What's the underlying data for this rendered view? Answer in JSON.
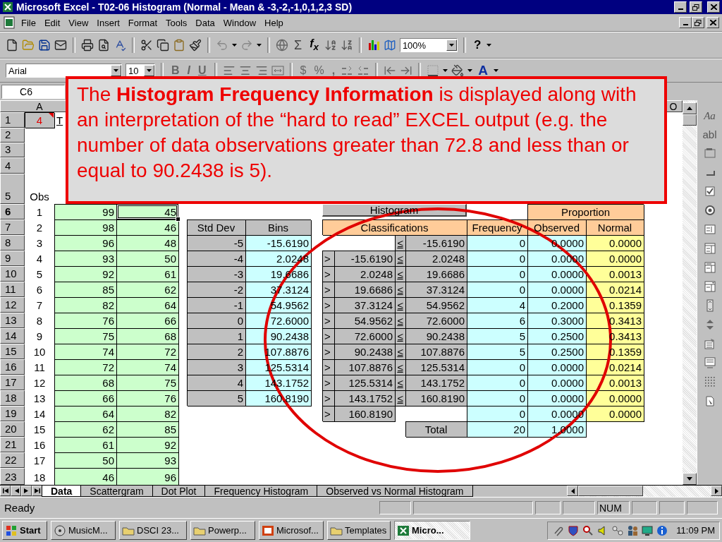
{
  "window": {
    "title": "Microsoft Excel - T02-06 Histogram (Normal - Mean & -3,-2,-1,0,1,2,3 SD)"
  },
  "menu": [
    "File",
    "Edit",
    "View",
    "Insert",
    "Format",
    "Tools",
    "Data",
    "Window",
    "Help"
  ],
  "standard_toolbar": {
    "autosum": "Σ",
    "function": "f$_{x}$",
    "zoom": "100%",
    "help": "?"
  },
  "format_toolbar": {
    "font": "Arial",
    "size": "10",
    "bold": "B",
    "italic": "I",
    "underline": "U",
    "currency": "$",
    "percent": "%",
    "comma": ",",
    "font_color": "A"
  },
  "name_box": "C6",
  "column_headers": [
    "A",
    "O"
  ],
  "row_headers": [
    {
      "label": "1",
      "selected": false
    },
    {
      "label": "2",
      "selected": false
    },
    {
      "label": "3",
      "selected": false
    },
    {
      "label": "4",
      "selected": false
    },
    {
      "label": "5",
      "selected": false
    },
    {
      "label": "6",
      "selected": true
    },
    {
      "label": "7",
      "selected": false
    },
    {
      "label": "8",
      "selected": false
    },
    {
      "label": "9",
      "selected": false
    },
    {
      "label": "10",
      "selected": false
    },
    {
      "label": "11",
      "selected": false
    },
    {
      "label": "12",
      "selected": false
    },
    {
      "label": "13",
      "selected": false
    },
    {
      "label": "14",
      "selected": false
    },
    {
      "label": "15",
      "selected": false
    },
    {
      "label": "16",
      "selected": false
    },
    {
      "label": "17",
      "selected": false
    },
    {
      "label": "18",
      "selected": false
    },
    {
      "label": "19",
      "selected": false
    },
    {
      "label": "20",
      "selected": false
    },
    {
      "label": "21",
      "selected": false
    },
    {
      "label": "22",
      "selected": false
    },
    {
      "label": "23",
      "selected": false
    }
  ],
  "cell_a1": "4",
  "title_fragment": "T",
  "obs_header": "Obs",
  "obs_table": {
    "rows": [
      {
        "obs": "1",
        "cells": [
          {
            "text": "99",
            "selected": false
          },
          {
            "text": "45",
            "selected": true
          }
        ]
      },
      {
        "obs": "2",
        "cells": [
          {
            "text": "98",
            "selected": false
          },
          {
            "text": "46",
            "selected": false
          }
        ]
      },
      {
        "obs": "3",
        "cells": [
          {
            "text": "96",
            "selected": false
          },
          {
            "text": "48",
            "selected": false
          }
        ]
      },
      {
        "obs": "4",
        "cells": [
          {
            "text": "93",
            "selected": false
          },
          {
            "text": "50",
            "selected": false
          }
        ]
      },
      {
        "obs": "5",
        "cells": [
          {
            "text": "92",
            "selected": false
          },
          {
            "text": "61",
            "selected": false
          }
        ]
      },
      {
        "obs": "6",
        "cells": [
          {
            "text": "85",
            "selected": false
          },
          {
            "text": "62",
            "selected": false
          }
        ]
      },
      {
        "obs": "7",
        "cells": [
          {
            "text": "82",
            "selected": false
          },
          {
            "text": "64",
            "selected": false
          }
        ]
      },
      {
        "obs": "8",
        "cells": [
          {
            "text": "76",
            "selected": false
          },
          {
            "text": "66",
            "selected": false
          }
        ]
      },
      {
        "obs": "9",
        "cells": [
          {
            "text": "75",
            "selected": false
          },
          {
            "text": "68",
            "selected": false
          }
        ]
      },
      {
        "obs": "10",
        "cells": [
          {
            "text": "74",
            "selected": false
          },
          {
            "text": "72",
            "selected": false
          }
        ]
      },
      {
        "obs": "11",
        "cells": [
          {
            "text": "72",
            "selected": false
          },
          {
            "text": "74",
            "selected": false
          }
        ]
      },
      {
        "obs": "12",
        "cells": [
          {
            "text": "68",
            "selected": false
          },
          {
            "text": "75",
            "selected": false
          }
        ]
      },
      {
        "obs": "13",
        "cells": [
          {
            "text": "66",
            "selected": false
          },
          {
            "text": "76",
            "selected": false
          }
        ]
      },
      {
        "obs": "14",
        "cells": [
          {
            "text": "64",
            "selected": false
          },
          {
            "text": "82",
            "selected": false
          }
        ]
      },
      {
        "obs": "15",
        "cells": [
          {
            "text": "62",
            "selected": false
          },
          {
            "text": "85",
            "selected": false
          }
        ]
      },
      {
        "obs": "16",
        "cells": [
          {
            "text": "61",
            "selected": false
          },
          {
            "text": "92",
            "selected": false
          }
        ]
      },
      {
        "obs": "17",
        "cells": [
          {
            "text": "50",
            "selected": false
          },
          {
            "text": "93",
            "selected": false
          }
        ]
      },
      {
        "obs": "18",
        "cells": [
          {
            "text": "46",
            "selected": false
          },
          {
            "text": "96",
            "selected": false
          }
        ]
      }
    ]
  },
  "bins_table": {
    "headers": [
      "Std Dev",
      "Bins"
    ],
    "rows": [
      {
        "std_dev": "-5",
        "bin": "-15.6190"
      },
      {
        "std_dev": "-4",
        "bin": "2.0248"
      },
      {
        "std_dev": "-3",
        "bin": "19.6686"
      },
      {
        "std_dev": "-2",
        "bin": "37.3124"
      },
      {
        "std_dev": "-1",
        "bin": "54.9562"
      },
      {
        "std_dev": "0",
        "bin": "72.6000"
      },
      {
        "std_dev": "1",
        "bin": "90.2438"
      },
      {
        "std_dev": "2",
        "bin": "107.8876"
      },
      {
        "std_dev": "3",
        "bin": "125.5314"
      },
      {
        "std_dev": "4",
        "bin": "143.1752"
      },
      {
        "std_dev": "5",
        "bin": "160.8190"
      }
    ]
  },
  "histogram": {
    "button": "Histogram",
    "group_header": "Proportion",
    "headers": [
      "Classifications",
      "Frequency",
      "Observed",
      "Normal"
    ],
    "classes": [
      {
        "le": "≤",
        "upper": "-15.6190",
        "frequency": "0",
        "observed": "0.0000",
        "normal": "0.0000"
      },
      {
        "gt": ">",
        "lower": "-15.6190",
        "le": "≤",
        "upper": "2.0248",
        "frequency": "0",
        "observed": "0.0000",
        "normal": "0.0000"
      },
      {
        "gt": ">",
        "lower": "2.0248",
        "le": "≤",
        "upper": "19.6686",
        "frequency": "0",
        "observed": "0.0000",
        "normal": "0.0013"
      },
      {
        "gt": ">",
        "lower": "19.6686",
        "le": "≤",
        "upper": "37.3124",
        "frequency": "0",
        "observed": "0.0000",
        "normal": "0.0214"
      },
      {
        "gt": ">",
        "lower": "37.3124",
        "le": "≤",
        "upper": "54.9562",
        "frequency": "4",
        "observed": "0.2000",
        "normal": "0.1359"
      },
      {
        "gt": ">",
        "lower": "54.9562",
        "le": "≤",
        "upper": "72.6000",
        "frequency": "6",
        "observed": "0.3000",
        "normal": "0.3413"
      },
      {
        "gt": ">",
        "lower": "72.6000",
        "le": "≤",
        "upper": "90.2438",
        "frequency": "5",
        "observed": "0.2500",
        "normal": "0.3413"
      },
      {
        "gt": ">",
        "lower": "90.2438",
        "le": "≤",
        "upper": "107.8876",
        "frequency": "5",
        "observed": "0.2500",
        "normal": "0.1359"
      },
      {
        "gt": ">",
        "lower": "107.8876",
        "le": "≤",
        "upper": "125.5314",
        "frequency": "0",
        "observed": "0.0000",
        "normal": "0.0214"
      },
      {
        "gt": ">",
        "lower": "125.5314",
        "le": "≤",
        "upper": "143.1752",
        "frequency": "0",
        "observed": "0.0000",
        "normal": "0.0013"
      },
      {
        "gt": ">",
        "lower": "143.1752",
        "le": "≤",
        "upper": "160.8190",
        "frequency": "0",
        "observed": "0.0000",
        "normal": "0.0000"
      },
      {
        "gt": ">",
        "lower": "160.8190",
        "frequency": "0",
        "observed": "0.0000",
        "normal": "0.0000"
      }
    ],
    "total": {
      "label": "Total",
      "frequency": "20",
      "observed": "1.0000"
    }
  },
  "callout": {
    "text": "The **Histogram Frequency Information** is displayed along with an interpretation of the “hard to read” EXCEL output (e.g. the number of data observations greater than 72.8 and less than or equal to 90.2438 is 5)."
  },
  "forms_toolbar": [
    {
      "kind": "label",
      "text": "Aa"
    },
    {
      "kind": "edit",
      "text": "abl"
    }
  ],
  "sheet_tabs": [
    {
      "label": "Data",
      "selected": true
    },
    {
      "label": "Scattergram",
      "selected": false
    },
    {
      "label": "Dot Plot",
      "selected": false
    },
    {
      "label": "Frequency Histogram",
      "selected": false
    },
    {
      "label": "Observed vs Normal Histogram",
      "selected": false
    }
  ],
  "status_bar": {
    "text": "Ready",
    "indicator": "NUM"
  },
  "taskbar": {
    "start": "Start",
    "tasks": [
      {
        "label": "MusicM...",
        "kind": "music",
        "selected": false
      },
      {
        "label": "DSCI 23...",
        "kind": "folder",
        "selected": false
      },
      {
        "label": "Powerp...",
        "kind": "folder",
        "selected": false
      },
      {
        "label": "Microsof...",
        "kind": "slides",
        "selected": false
      },
      {
        "label": "Templates",
        "kind": "folder",
        "selected": false
      },
      {
        "label": "Micro...",
        "kind": "excel",
        "selected": true
      }
    ],
    "clock": "11:09 PM"
  }
}
